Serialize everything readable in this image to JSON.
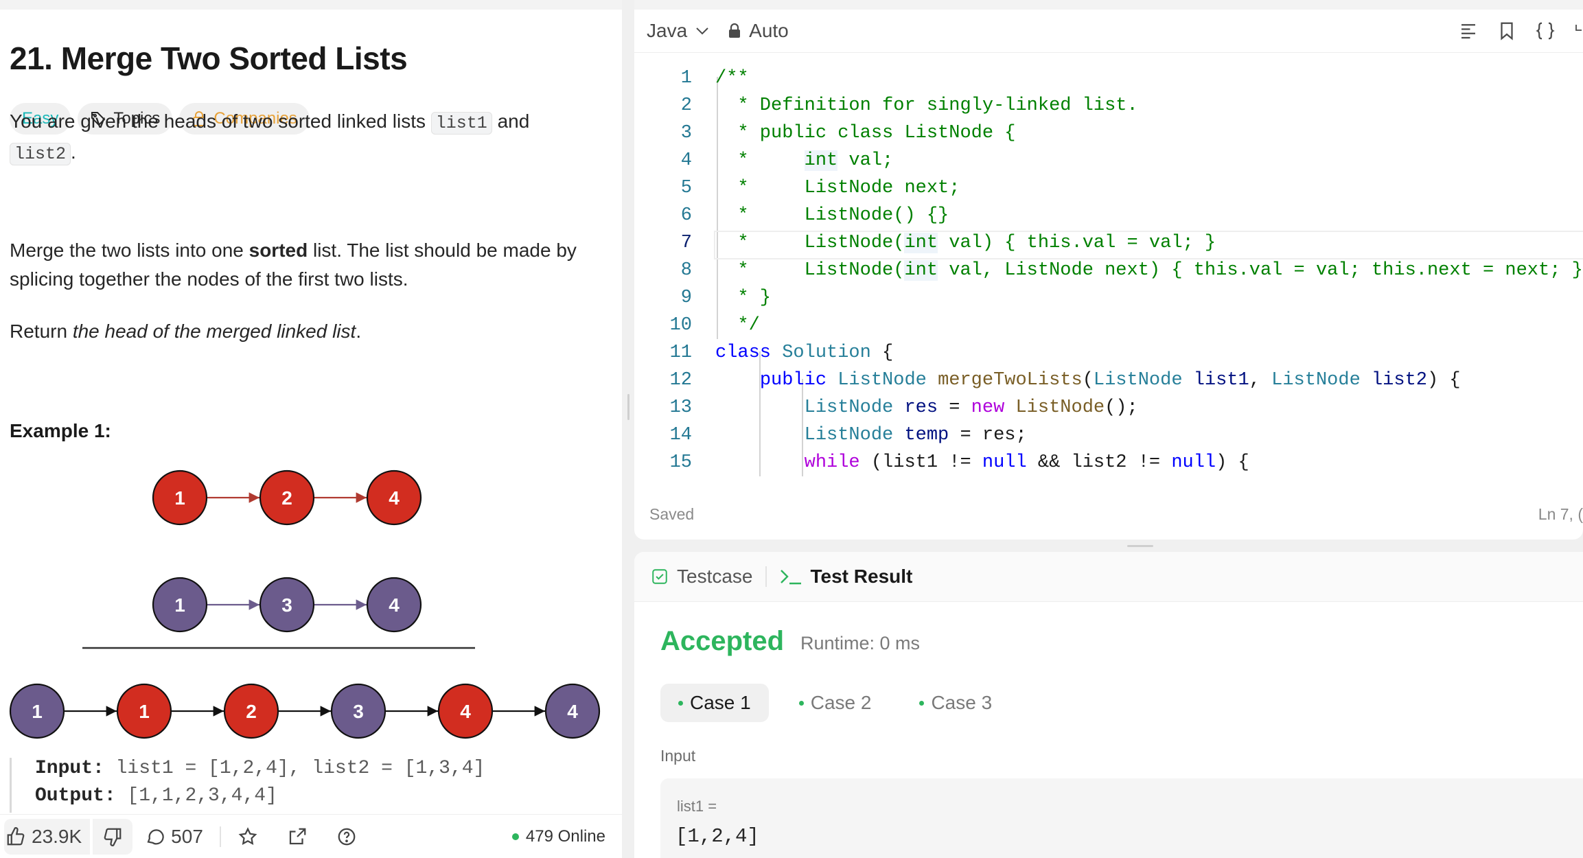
{
  "problem": {
    "title": "21. Merge Two Sorted Lists",
    "tags": {
      "difficulty": "Easy",
      "topics": "Topics",
      "companies": "Companies"
    },
    "desc1_before": "You are given the heads of two sorted linked lists ",
    "code_list1": "list1",
    "desc1_mid": " and ",
    "code_list2": "list2",
    "desc1_after": ".",
    "desc2_before": "Merge the two lists into one ",
    "desc2_bold": "sorted",
    "desc2_after": " list. The list should be made by splicing together the nodes of the first two lists.",
    "desc3_before": "Return ",
    "desc3_italic": "the head of the merged linked list",
    "desc3_after": ".",
    "example_title": "Example 1:",
    "input_label": "Input:",
    "input_value": " list1 = [1,2,4], list2 = [1,3,4]",
    "output_label": "Output:",
    "output_value": " [1,1,2,3,4,4]"
  },
  "diagram": {
    "list1": [
      "1",
      "2",
      "4"
    ],
    "list2": [
      "1",
      "3",
      "4"
    ],
    "merged": [
      "1",
      "1",
      "2",
      "3",
      "4",
      "4"
    ],
    "merged_colors": [
      "purple",
      "red",
      "red",
      "purple",
      "red",
      "purple"
    ],
    "colors": {
      "red": "#d22d20",
      "purple": "#6b5b8c",
      "red_arrow": "#b03a30",
      "purple_arrow": "#6b5b8c"
    }
  },
  "bottom_bar": {
    "likes": "23.9K",
    "comments": "507",
    "online": "479 Online",
    "icons": [
      "thumbs-up-icon",
      "thumbs-down-icon",
      "comment-icon",
      "star-icon",
      "share-icon",
      "help-icon"
    ]
  },
  "editor": {
    "language": "Java",
    "mode": "Auto",
    "status": "Saved",
    "cursor": "Ln 7, (",
    "lines": [
      "1",
      "2",
      "3",
      "4",
      "5",
      "6",
      "7",
      "8",
      "9",
      "10",
      "11",
      "12",
      "13",
      "14",
      "15"
    ]
  },
  "result": {
    "tab_testcase": "Testcase",
    "tab_result": "Test Result",
    "verdict": "Accepted",
    "runtime": "Runtime: 0 ms",
    "cases": [
      "Case 1",
      "Case 2",
      "Case 3"
    ],
    "input_label": "Input",
    "var_label": "list1 =",
    "var_value": "[1,2,4]"
  },
  "theme": {
    "accent_green": "#2db55d",
    "easy": "#1cb8b8",
    "companies": "#e7a23a"
  }
}
